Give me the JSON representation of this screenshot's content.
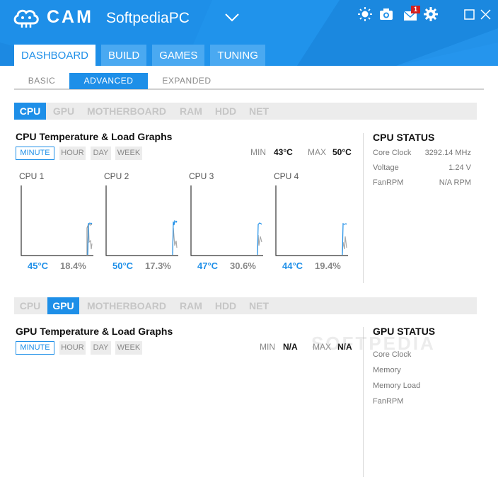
{
  "app": {
    "logo_text": "CAM",
    "profile_name": "SoftpediaPC",
    "notification_count": "1",
    "icons": [
      "sun-icon",
      "camera-icon",
      "mail-icon",
      "gear-icon",
      "maximize-icon",
      "close-icon"
    ],
    "accent_color": "#1e8fe8"
  },
  "main_tabs": [
    "DASHBOARD",
    "BUILD",
    "GAMES",
    "TUNING"
  ],
  "sub_tabs": [
    "BASIC",
    "ADVANCED",
    "EXPANDED"
  ],
  "components": [
    "CPU",
    "GPU",
    "MOTHERBOARD",
    "RAM",
    "HDD",
    "NET"
  ],
  "ranges": [
    "MINUTE",
    "HOUR",
    "DAY",
    "WEEK"
  ],
  "cpu_section": {
    "title": "CPU Temperature & Load Graphs",
    "min_label": "MIN",
    "min_value": "43°C",
    "max_label": "MAX",
    "max_value": "50°C",
    "graphs": [
      {
        "label": "CPU 1",
        "temp": "45°C",
        "load": "18.4%"
      },
      {
        "label": "CPU 2",
        "temp": "50°C",
        "load": "17.3%"
      },
      {
        "label": "CPU 3",
        "temp": "47°C",
        "load": "30.6%"
      },
      {
        "label": "CPU 4",
        "temp": "44°C",
        "load": "19.4%"
      }
    ],
    "status_title": "CPU STATUS",
    "status": [
      {
        "key": "Core Clock",
        "value": "3292.14 MHz"
      },
      {
        "key": "Voltage",
        "value": "1.24 V"
      },
      {
        "key": "FanRPM",
        "value": "N/A RPM"
      }
    ]
  },
  "gpu_section": {
    "title": "GPU Temperature & Load Graphs",
    "min_label": "MIN",
    "min_value": "N/A",
    "max_label": "MAX",
    "max_value": "N/A",
    "status_title": "GPU STATUS",
    "status": [
      {
        "key": "Core Clock"
      },
      {
        "key": "Memory"
      },
      {
        "key": "Memory Load"
      },
      {
        "key": "FanRPM"
      }
    ]
  },
  "watermark": "SOFTPEDIA"
}
